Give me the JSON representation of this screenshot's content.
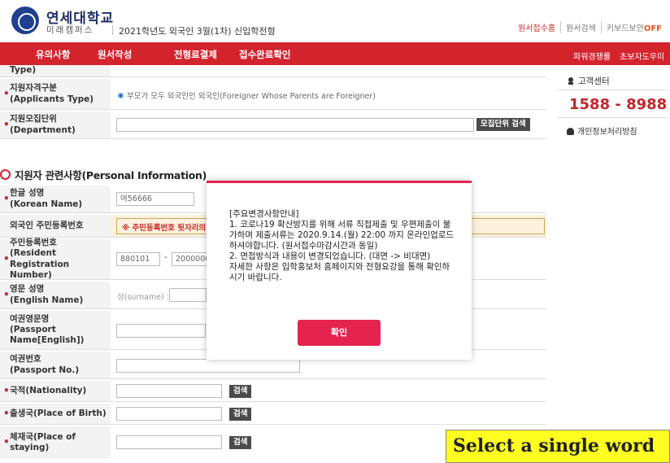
{
  "header": {
    "uni_name": "연세대학교",
    "campus_name": "미래캠퍼스",
    "exam_title": "2021학년도 외국인 3월(1차) 신입학전형",
    "links": [
      "원서접수홈",
      "원서검색",
      "키보드보안"
    ],
    "keyboard_security_state": "OFF"
  },
  "nav": {
    "items": [
      "유의사항",
      "원서작성",
      "전형료결제",
      "접수완료확인"
    ],
    "right": [
      "파워경쟁률",
      "초보자도우미"
    ]
  },
  "form": {
    "type_label_tail": "Type)",
    "applicants_type": {
      "label_ko": "지원자격구분",
      "label_en": "(Applicants Type)",
      "value": "부모가 모두 외국인인 외국인(Foreigner Whose Parents are Foreigner)"
    },
    "department": {
      "label_ko": "지원모집단위",
      "label_en": "(Department)",
      "search_btn": "모집단위 검색"
    },
    "section_title": "지원자 관련사항(Personal Information)",
    "korean_name": {
      "label_ko": "한글 성명",
      "label_en": "(Korean Name)",
      "value": "여56666"
    },
    "foreign_reg": {
      "label": "외국인 주민등록번호",
      "warning": "※ 주민등록번호 뒷자리의"
    },
    "resident_reg": {
      "label_ko": "주민등록번호",
      "label_en1": "(Resident Registration",
      "label_en2": "Number)",
      "front": "880101",
      "dash": "-",
      "back": "2000000"
    },
    "english_name": {
      "label_ko": "영문 성명",
      "label_en": "(English Name)",
      "placeholder": "성(surname) :"
    },
    "passport_name": {
      "label_ko": "여권영문명",
      "label_en1": "(Passport",
      "label_en2": "Name[English])"
    },
    "passport_no": {
      "label_ko": "여권번호",
      "label_en": "(Passport No.)"
    },
    "nationality": {
      "label": "국적(Nationality)",
      "btn": "검색"
    },
    "birth_place": {
      "label": "출생국(Place of Birth)",
      "btn": "검색"
    },
    "staying": {
      "label_ko": "체재국(Place of",
      "label_en": "staying)",
      "btn": "검색"
    }
  },
  "right_panel": {
    "cs_label": "고객센터",
    "cs_number": "1588 - 8988",
    "privacy": "개인정보처리방침"
  },
  "modal": {
    "text": "[주요변경사항안내]\n1. 코로나19 확산방지를 위해 서류 직접제출 및 우편제출이 불가하며 제출서류는 2020.9.14.(월) 22:00 까지 온라인업로드 하셔야합니다. (원서접수마감시간과 동일)\n2. 면접방식과 내용이 변경되었습니다. (대면 -> 비대면)\n자세한 사항은 입학홍보처 홈페이지와 전형요강을 통해 확인하시기 바랍니다.",
    "confirm": "확인"
  },
  "overlay": {
    "text": "Select a single word"
  }
}
